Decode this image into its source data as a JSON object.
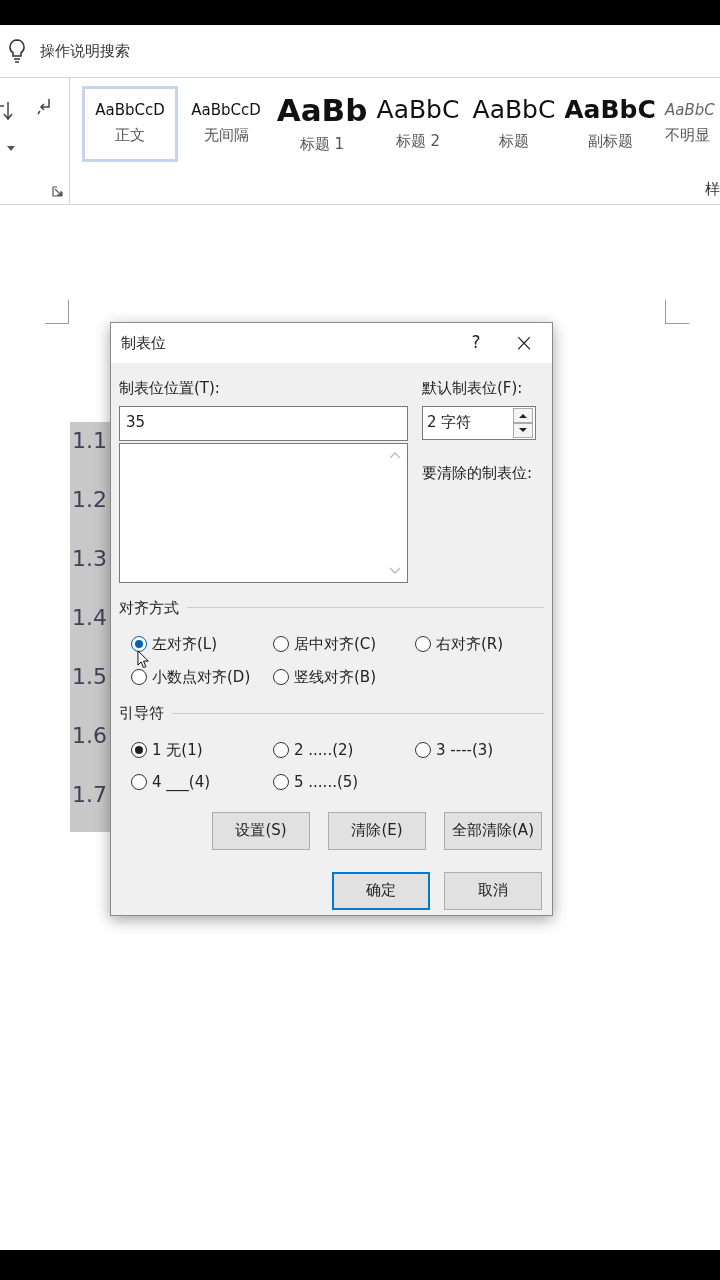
{
  "search": {
    "text": "操作说明搜索"
  },
  "styles": [
    {
      "sample": "AaBbCcD",
      "name": "正文",
      "kind": "normal",
      "selected": true
    },
    {
      "sample": "AaBbCcD",
      "name": "无间隔",
      "kind": "normal",
      "selected": false
    },
    {
      "sample": "AaBb",
      "name": "标题 1",
      "kind": "heading1",
      "selected": false
    },
    {
      "sample": "AaBbC",
      "name": "标题 2",
      "kind": "heading2",
      "selected": false
    },
    {
      "sample": "AaBbC",
      "name": "标题",
      "kind": "title",
      "selected": false
    },
    {
      "sample": "AaBbC",
      "name": "副标题",
      "kind": "subtitle",
      "selected": false
    },
    {
      "sample": "AaBbC",
      "name": "不明显",
      "kind": "subtle",
      "selected": false
    }
  ],
  "styles_group_label": "样",
  "document": {
    "lines": [
      "1.1",
      "1.2",
      "1.3",
      "1.4",
      "1.5",
      "1.6",
      "1.7"
    ]
  },
  "dialog": {
    "title": "制表位",
    "help": "?",
    "close": "×",
    "tab_position_label": "制表位位置(T):",
    "tab_position_value": "35",
    "default_label": "默认制表位(F):",
    "default_value": "2 字符",
    "clear_label": "要清除的制表位:",
    "alignment_label": "对齐方式",
    "alignment": [
      {
        "label": "左对齐(L)",
        "selected": true
      },
      {
        "label": "居中对齐(C)",
        "selected": false
      },
      {
        "label": "右对齐(R)",
        "selected": false
      },
      {
        "label": "小数点对齐(D)",
        "selected": false
      },
      {
        "label": "竖线对齐(B)",
        "selected": false
      }
    ],
    "leader_label": "引导符",
    "leader": [
      {
        "label": "1 无(1)",
        "selected": true
      },
      {
        "label": "2 .....(2)",
        "selected": false
      },
      {
        "label": "3 ----(3)",
        "selected": false
      },
      {
        "label": "4 ___(4)",
        "selected": false
      },
      {
        "label": "5 ......(5)",
        "selected": false
      }
    ],
    "action_buttons": [
      "设置(S)",
      "清除(E)",
      "全部清除(A)"
    ],
    "buttons": [
      {
        "label": "确定",
        "kind": "default"
      },
      {
        "label": "取消",
        "kind": "normal"
      }
    ]
  }
}
